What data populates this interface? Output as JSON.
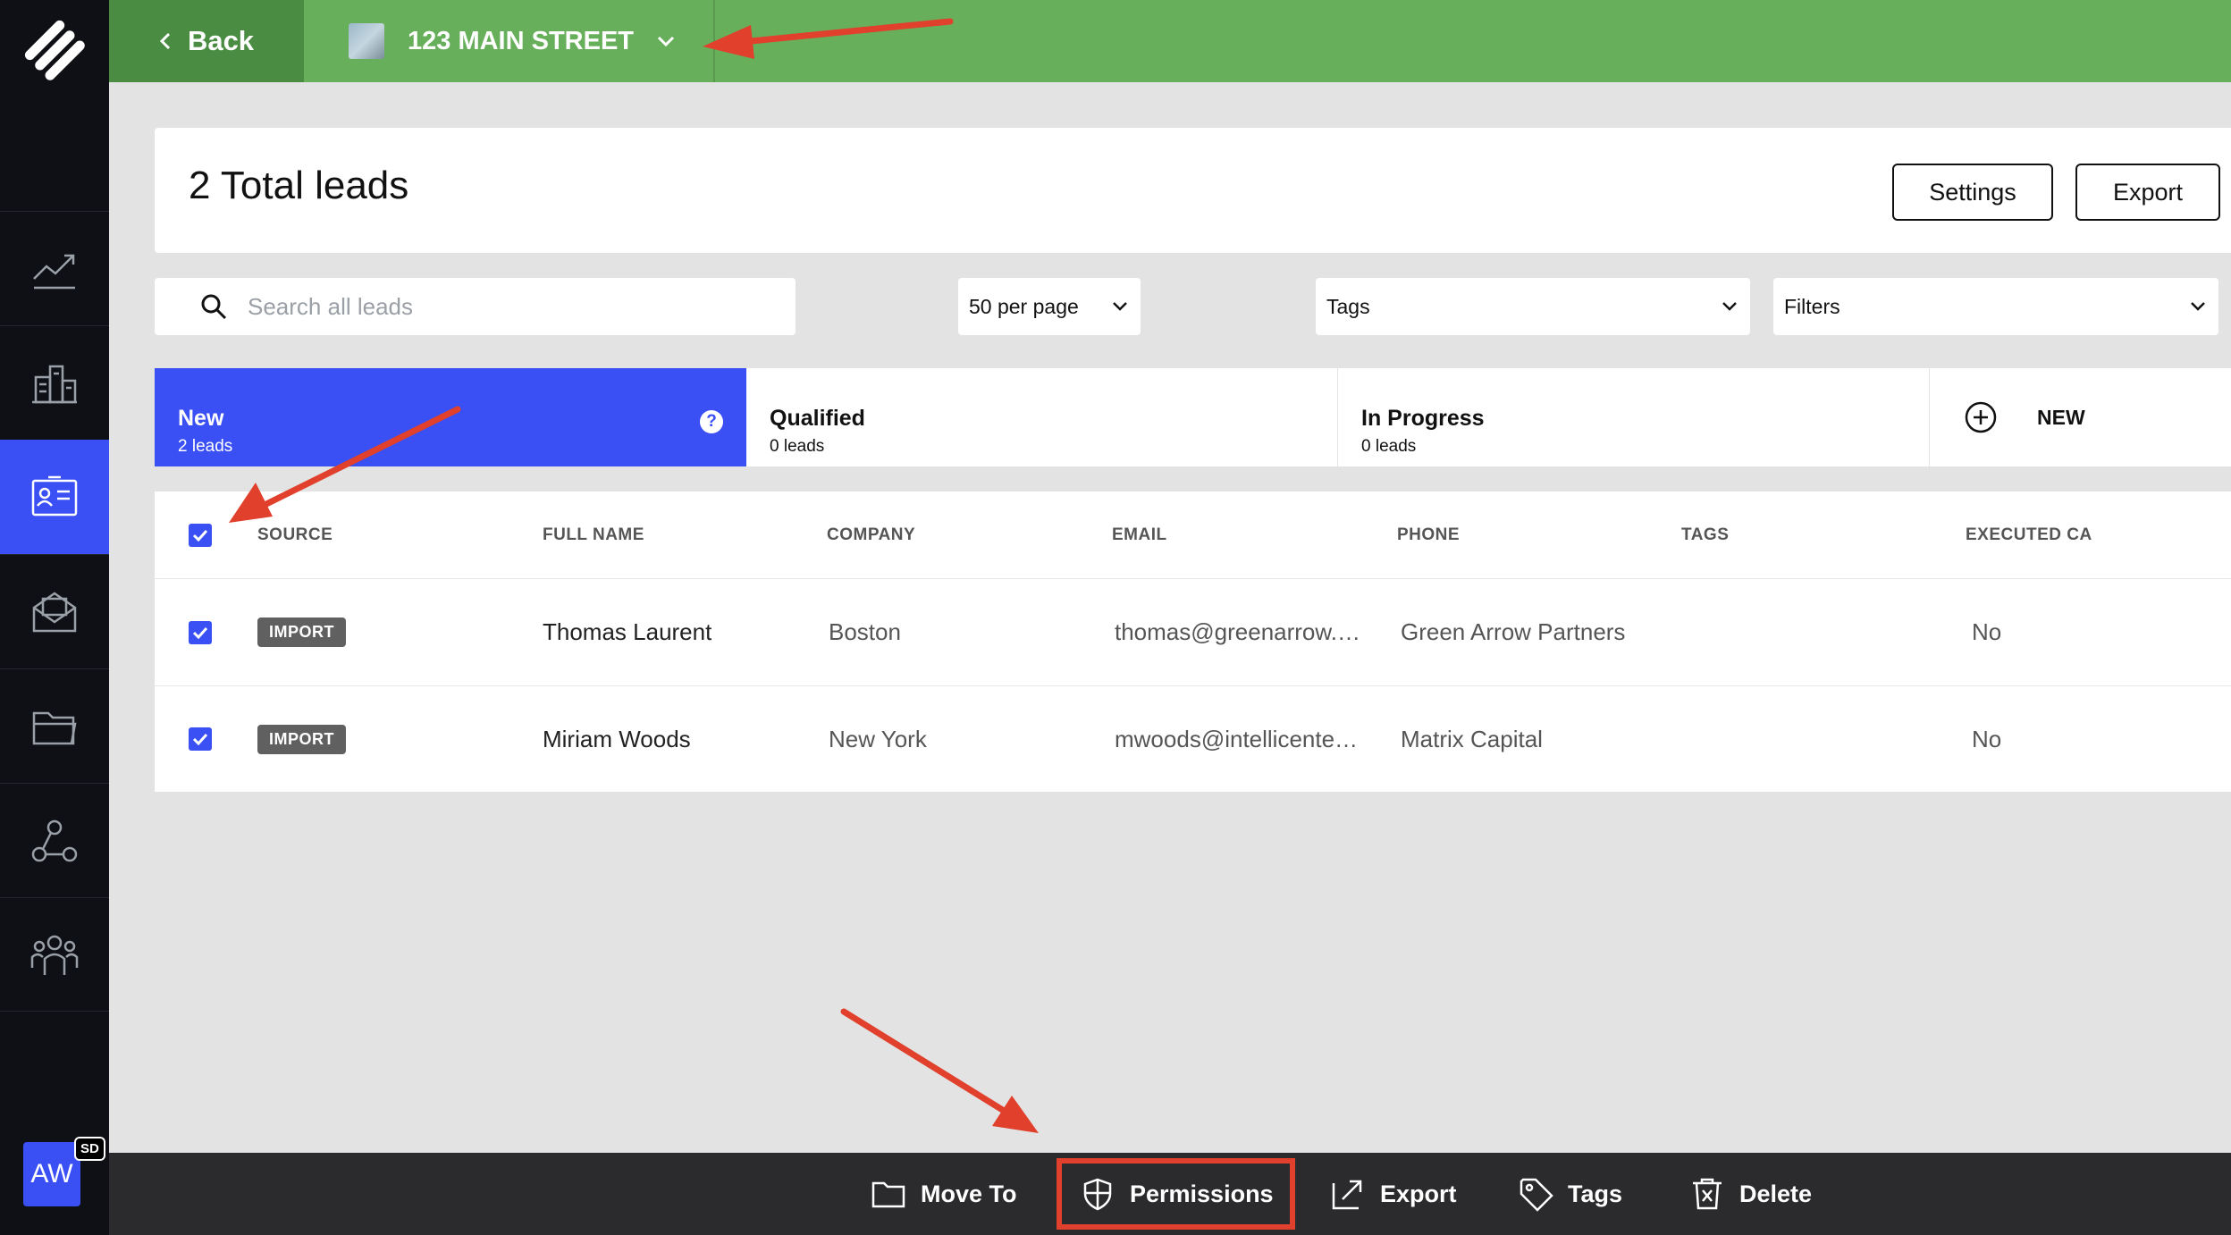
{
  "topbar": {
    "back_label": "Back",
    "property_name": "123 MAIN STREET"
  },
  "header": {
    "title": "2 Total leads",
    "settings_label": "Settings",
    "export_label": "Export"
  },
  "filters": {
    "search_placeholder": "Search all leads",
    "per_page": "50 per page",
    "tags": "Tags",
    "filters": "Filters"
  },
  "stages": [
    {
      "name": "New",
      "count": "2 leads"
    },
    {
      "name": "Qualified",
      "count": "0 leads"
    },
    {
      "name": "In Progress",
      "count": "0 leads"
    }
  ],
  "new_stage_label": "NEW",
  "table": {
    "columns": [
      "SOURCE",
      "FULL NAME",
      "COMPANY",
      "EMAIL",
      "PHONE",
      "TAGS",
      "EXECUTED CA"
    ],
    "rows": [
      {
        "source": "IMPORT",
        "full_name": "Thomas Laurent",
        "company": "Boston",
        "email": "thomas@greenarrow.…",
        "phone": "Green Arrow Partners",
        "tags": "",
        "executed_ca": "No"
      },
      {
        "source": "IMPORT",
        "full_name": "Miriam Woods",
        "company": "New York",
        "email": "mwoods@intellicente…",
        "phone": "Matrix Capital",
        "tags": "",
        "executed_ca": "No"
      }
    ]
  },
  "actions": {
    "move_to": "Move To",
    "permissions": "Permissions",
    "export": "Export",
    "tags": "Tags",
    "delete": "Delete"
  },
  "user": {
    "initials": "AW",
    "badge": "SD"
  },
  "colors": {
    "accent": "#3a50f5",
    "topbar": "#68af5c",
    "back_button": "#4a8c42",
    "annotation": "#e0402c"
  }
}
